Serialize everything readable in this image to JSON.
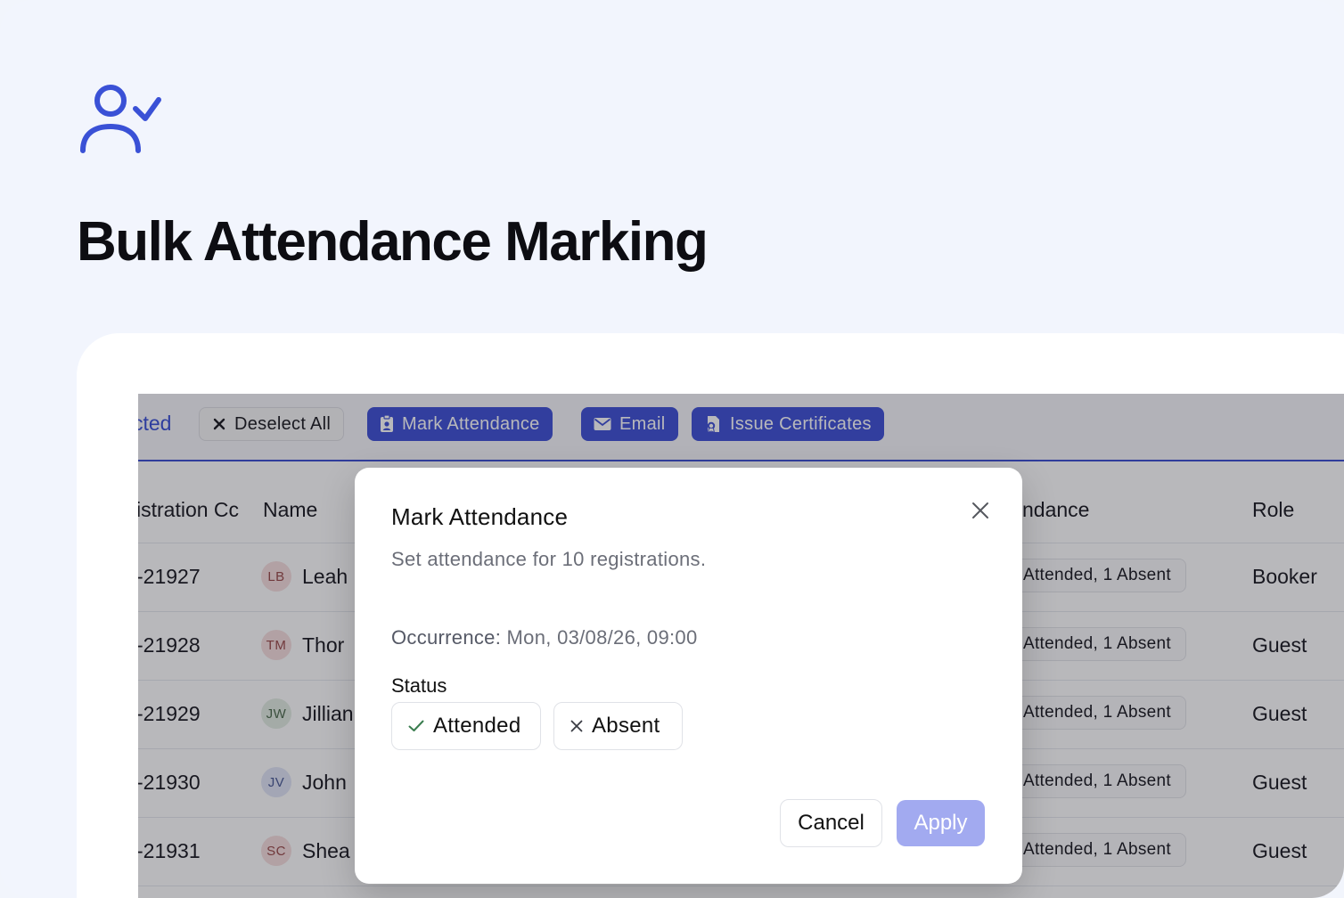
{
  "hero": {
    "title": "Bulk Attendance Marking",
    "icon": "user-check-icon",
    "accent": "#3a51d6"
  },
  "toolbar": {
    "selected_text": "cted",
    "deselect_label": "Deselect All",
    "mark_label": "Mark Attendance",
    "email_label": "Email",
    "certificates_label": "Issue Certificates"
  },
  "table": {
    "headers": {
      "registration": "istration Cc",
      "name": "Name",
      "attendance": "ndance",
      "role": "Role"
    },
    "rows": [
      {
        "code": "-21927",
        "initials": "LB",
        "name": "Leah",
        "attendance": "Attended, 1 Absent",
        "role": "Booker",
        "avatar_bg": "#f6dede",
        "avatar_fg": "#9a4a4a"
      },
      {
        "code": "-21928",
        "initials": "TM",
        "name": "Thor",
        "attendance": "Attended, 1 Absent",
        "role": "Guest",
        "avatar_bg": "#f6dede",
        "avatar_fg": "#9a4a4a"
      },
      {
        "code": "-21929",
        "initials": "JW",
        "name": "Jillian",
        "attendance": "Attended, 1 Absent",
        "role": "Guest",
        "avatar_bg": "#e2ece2",
        "avatar_fg": "#4d6a4d"
      },
      {
        "code": "-21930",
        "initials": "JV",
        "name": "John",
        "attendance": "Attended, 1 Absent",
        "role": "Guest",
        "avatar_bg": "#e1e6f7",
        "avatar_fg": "#4a5a96"
      },
      {
        "code": "-21931",
        "initials": "SC",
        "name": "Shea",
        "attendance": "Attended, 1 Absent",
        "role": "Guest",
        "avatar_bg": "#f6dede",
        "avatar_fg": "#9a4a4a"
      }
    ]
  },
  "modal": {
    "title": "Mark Attendance",
    "description": "Set attendance for 10 registrations.",
    "occurrence_label": "Occurrence:",
    "occurrence_value": "Mon, 03/08/26, 09:00",
    "status_label": "Status",
    "attended_label": "Attended",
    "absent_label": "Absent",
    "cancel_label": "Cancel",
    "apply_label": "Apply"
  }
}
